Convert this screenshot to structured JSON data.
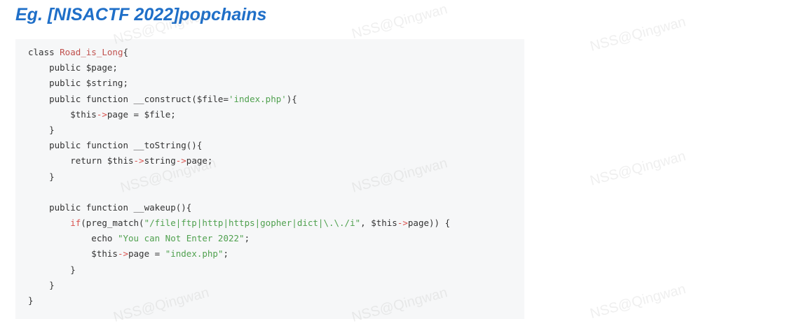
{
  "heading": "Eg. [NISACTF 2022]popchains",
  "watermark": "NSS@Qingwan",
  "code": {
    "class_kw": "class ",
    "class_name": "Road_is_Long",
    "open_brace": "{",
    "line2": "    public $page;",
    "line3": "    public $string;",
    "line4_pre": "    public function __construct($file=",
    "line4_str": "'index.php'",
    "line4_post": "){",
    "line5_pre": "        $this",
    "arrow": "->",
    "line5_post": "page = $file;",
    "close_inner": "    }",
    "line7": "    public function __toString(){",
    "line8_pre": "        return $this",
    "line8_mid": "string",
    "line8_post": "page;",
    "line11": "    public function __wakeup(){",
    "line12_kw": "        if",
    "line12_a": "(preg_match(",
    "line12_str": "\"/file|ftp|http|https|gopher|dict|\\.\\./i\"",
    "line12_b": ", $this",
    "line12_c": "page)) {",
    "line13_pre": "            echo ",
    "line13_str": "\"You can Not Enter 2022\"",
    "line13_post": ";",
    "line14_pre": "            $this",
    "line14_mid": "page = ",
    "line14_str": "\"index.php\"",
    "line14_post": ";",
    "close_if": "        }",
    "close_outer": "}"
  }
}
